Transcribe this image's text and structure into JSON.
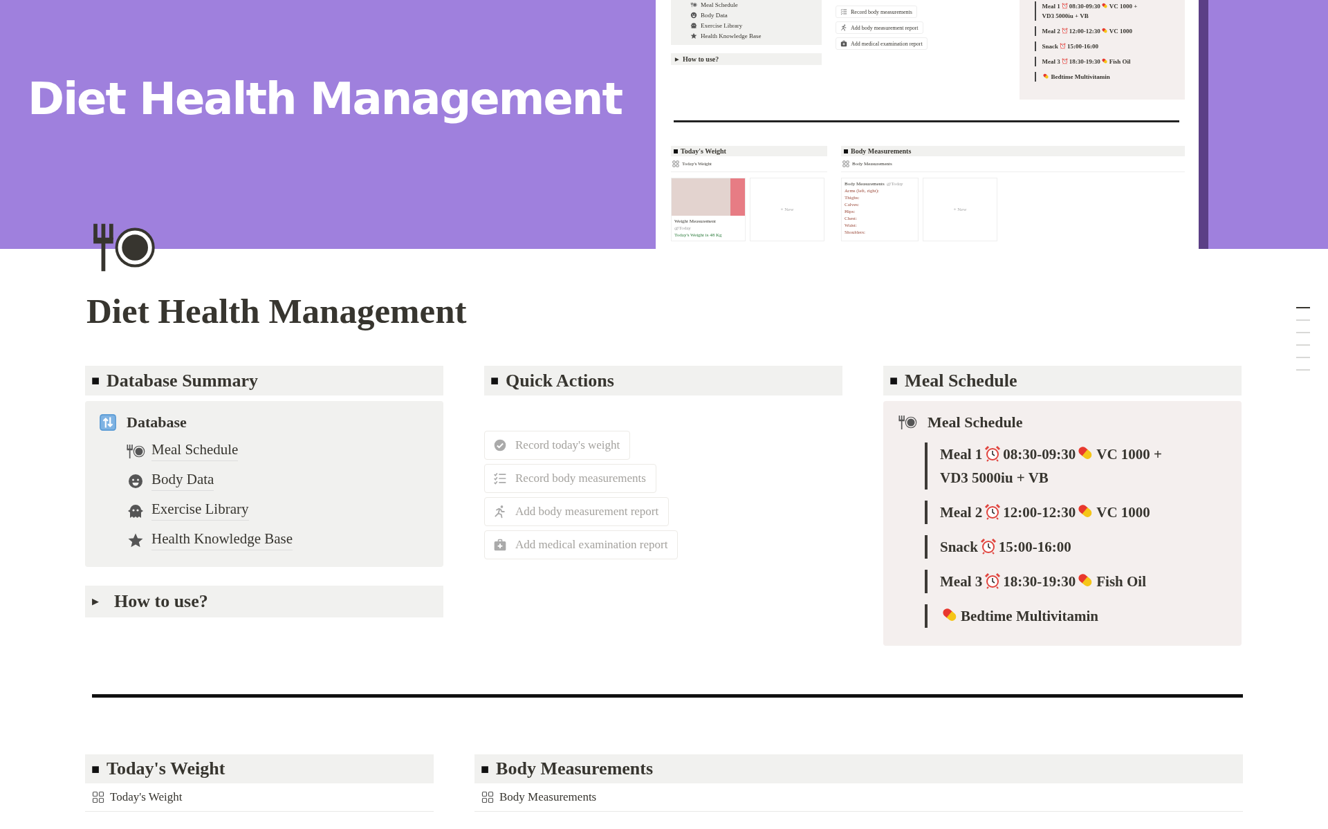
{
  "cover": {
    "title": "Diet Health Management",
    "preview": {
      "database_items": [
        "Meal Schedule",
        "Body Data",
        "Exercise Library",
        "Health Knowledge Base"
      ],
      "how_to_use": "How to use?",
      "actions": [
        "Record body measurements",
        "Add body measurement report",
        "Add medical examination report"
      ],
      "meal_lines": [
        {
          "segments": [
            {
              "kind": "text",
              "text": "Meal 1"
            },
            {
              "kind": "clock"
            },
            {
              "kind": "text",
              "text": "08:30-09:30"
            },
            {
              "kind": "pill"
            },
            {
              "kind": "text",
              "text": "VC 1000 +"
            },
            {
              "kind": "text",
              "text": "VD3 5000iu + VB"
            }
          ]
        },
        {
          "segments": [
            {
              "kind": "text",
              "text": "Meal 2"
            },
            {
              "kind": "clock"
            },
            {
              "kind": "text",
              "text": "12:00-12:30"
            },
            {
              "kind": "pill"
            },
            {
              "kind": "text",
              "text": "VC 1000"
            }
          ]
        },
        {
          "segments": [
            {
              "kind": "text",
              "text": "Snack"
            },
            {
              "kind": "clock"
            },
            {
              "kind": "text",
              "text": "15:00-16:00"
            }
          ]
        },
        {
          "segments": [
            {
              "kind": "text",
              "text": "Meal 3"
            },
            {
              "kind": "clock"
            },
            {
              "kind": "text",
              "text": "18:30-19:30"
            },
            {
              "kind": "pill"
            },
            {
              "kind": "text",
              "text": "Fish Oil"
            }
          ]
        },
        {
          "segments": [
            {
              "kind": "pill"
            },
            {
              "kind": "text",
              "text": "Bedtime Multivitamin"
            }
          ]
        }
      ],
      "weight": {
        "heading": "Today's Weight",
        "view": "Today's Weight",
        "card_title": "Weight Measurement",
        "card_date": "@Today",
        "card_note": "Today's Weight is 48 Kg",
        "new_label": "+ New"
      },
      "measurements": {
        "heading": "Body Measurements",
        "view": "Body Measurements",
        "card_title": "Body Measurements",
        "card_date": "@Today",
        "fields": [
          "Arms (left, right):",
          "Thighs:",
          "Calves:",
          "Hips:",
          "Chest:",
          "Waist:",
          "Shoulders:"
        ],
        "new_label": "+ New"
      }
    }
  },
  "title": "Diet Health Management",
  "database_summary": {
    "heading": "Database Summary",
    "mark": "■",
    "callout_title": "Database",
    "items": [
      "Meal Schedule",
      "Body Data",
      "Exercise Library",
      "Health Knowledge Base"
    ]
  },
  "how_to_use": {
    "label": "How to use?",
    "arrow": "▶",
    "expanded": false
  },
  "quick_actions": {
    "heading": "Quick Actions",
    "mark": "■",
    "buttons": [
      "Record today's weight",
      "Record body measurements",
      "Add body measurement report",
      "Add medical examination report"
    ]
  },
  "meal_schedule": {
    "heading": "Meal Schedule",
    "mark": "■",
    "callout_title": "Meal Schedule",
    "lines": [
      {
        "segments": [
          {
            "kind": "text",
            "text": "Meal 1"
          },
          {
            "kind": "clock"
          },
          {
            "kind": "text",
            "text": "08:30-09:30"
          },
          {
            "kind": "pill"
          },
          {
            "kind": "text",
            "text": "VC 1000 +"
          },
          {
            "kind": "text",
            "text": "VD3 5000iu + VB"
          }
        ]
      },
      {
        "segments": [
          {
            "kind": "text",
            "text": "Meal 2"
          },
          {
            "kind": "clock"
          },
          {
            "kind": "text",
            "text": "12:00-12:30"
          },
          {
            "kind": "pill"
          },
          {
            "kind": "text",
            "text": "VC 1000"
          }
        ]
      },
      {
        "segments": [
          {
            "kind": "text",
            "text": "Snack"
          },
          {
            "kind": "clock"
          },
          {
            "kind": "text",
            "text": "15:00-16:00"
          }
        ]
      },
      {
        "segments": [
          {
            "kind": "text",
            "text": "Meal 3"
          },
          {
            "kind": "clock"
          },
          {
            "kind": "text",
            "text": "18:30-19:30"
          },
          {
            "kind": "pill"
          },
          {
            "kind": "text",
            "text": "Fish Oil"
          }
        ]
      },
      {
        "segments": [
          {
            "kind": "pill"
          },
          {
            "kind": "text",
            "text": "Bedtime Multivitamin"
          }
        ]
      }
    ]
  },
  "todays_weight": {
    "heading": "Today's Weight",
    "mark": "■",
    "view": "Today's Weight"
  },
  "body_measurements": {
    "heading": "Body Measurements",
    "mark": "■",
    "view": "Body Measurements"
  },
  "outline": [
    {
      "selected": true
    },
    {
      "selected": false
    },
    {
      "selected": false
    },
    {
      "selected": false
    },
    {
      "selected": false
    },
    {
      "selected": false
    }
  ]
}
